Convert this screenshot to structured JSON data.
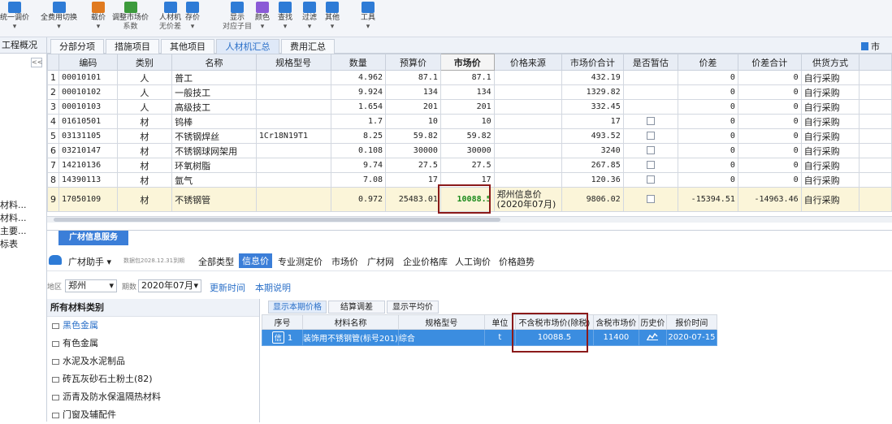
{
  "toolbar": [
    {
      "label": "统一调价",
      "sub": "",
      "color": "#2e7bd6",
      "icon": "adjust-price-icon"
    },
    {
      "label": "全费用切换",
      "sub": "",
      "color": "#2e7bd6",
      "icon": "full-cost-icon"
    },
    {
      "label": "载价",
      "sub": "",
      "color": "#e07a20",
      "icon": "load-price-icon"
    },
    {
      "label": "调整市场价",
      "sub": "系数",
      "color": "#3c9a3c",
      "icon": "coefficient-icon"
    },
    {
      "label": "人材机",
      "sub": "无价差",
      "color": "#2e7bd6",
      "icon": "scale-icon"
    },
    {
      "label": "存价",
      "sub": "",
      "color": "#2e7bd6",
      "icon": "save-price-icon"
    },
    {
      "label": "显示",
      "sub": "对应子目",
      "color": "#2e7bd6",
      "icon": "display-icon"
    },
    {
      "label": "颜色",
      "sub": "",
      "color": "#8a5ad6",
      "icon": "color-icon"
    },
    {
      "label": "查找",
      "sub": "",
      "color": "#2e7bd6",
      "icon": "find-icon"
    },
    {
      "label": "过滤",
      "sub": "",
      "color": "#2e7bd6",
      "icon": "filter-icon"
    },
    {
      "label": "其他",
      "sub": "",
      "color": "#2e7bd6",
      "icon": "other-icon"
    },
    {
      "label": "工具",
      "sub": "",
      "color": "#2e7bd6",
      "icon": "tools-icon"
    }
  ],
  "left": {
    "header": "工程概况",
    "items": [
      "材料...",
      "材料...",
      "主要...",
      "标表"
    ]
  },
  "tabs": [
    "分部分项",
    "措施项目",
    "其他项目",
    "人材机汇总",
    "费用汇总"
  ],
  "right_tab": "市",
  "grid": {
    "headers": [
      "",
      "编码",
      "类别",
      "名称",
      "规格型号",
      "数量",
      "预算价",
      "市场价",
      "价格来源",
      "市场价合计",
      "是否暂估",
      "价差",
      "价差合计",
      "供货方式"
    ],
    "rows": [
      {
        "no": "1",
        "code": "00010101",
        "cat": "人",
        "name": "普工",
        "spec": "",
        "qty": "4.962",
        "budget": "87.1",
        "market": "87.1",
        "src": "",
        "total": "432.19",
        "est": false,
        "diff": "0",
        "difftotal": "0",
        "supply": "自行采购"
      },
      {
        "no": "2",
        "code": "00010102",
        "cat": "人",
        "name": "一般技工",
        "spec": "",
        "qty": "9.924",
        "budget": "134",
        "market": "134",
        "src": "",
        "total": "1329.82",
        "est": false,
        "diff": "0",
        "difftotal": "0",
        "supply": "自行采购"
      },
      {
        "no": "3",
        "code": "00010103",
        "cat": "人",
        "name": "高级技工",
        "spec": "",
        "qty": "1.654",
        "budget": "201",
        "market": "201",
        "src": "",
        "total": "332.45",
        "est": false,
        "diff": "0",
        "difftotal": "0",
        "supply": "自行采购"
      },
      {
        "no": "4",
        "code": "01610501",
        "cat": "材",
        "name": "钨棒",
        "spec": "",
        "qty": "1.7",
        "budget": "10",
        "market": "10",
        "src": "",
        "total": "17",
        "est": true,
        "diff": "0",
        "difftotal": "0",
        "supply": "自行采购"
      },
      {
        "no": "5",
        "code": "03131105",
        "cat": "材",
        "name": "不锈钢焊丝",
        "spec": "1Cr18N19T1",
        "qty": "8.25",
        "budget": "59.82",
        "market": "59.82",
        "src": "",
        "total": "493.52",
        "est": true,
        "diff": "0",
        "difftotal": "0",
        "supply": "自行采购"
      },
      {
        "no": "6",
        "code": "03210147",
        "cat": "材",
        "name": "不锈钢球网架用",
        "spec": "",
        "qty": "0.108",
        "budget": "30000",
        "market": "30000",
        "src": "",
        "total": "3240",
        "est": true,
        "diff": "0",
        "difftotal": "0",
        "supply": "自行采购"
      },
      {
        "no": "7",
        "code": "14210136",
        "cat": "材",
        "name": "环氧树脂",
        "spec": "",
        "qty": "9.74",
        "budget": "27.5",
        "market": "27.5",
        "src": "",
        "total": "267.85",
        "est": true,
        "diff": "0",
        "difftotal": "0",
        "supply": "自行采购"
      },
      {
        "no": "8",
        "code": "14390113",
        "cat": "材",
        "name": "氩气",
        "spec": "",
        "qty": "7.08",
        "budget": "17",
        "market": "17",
        "src": "",
        "total": "120.36",
        "est": true,
        "diff": "0",
        "difftotal": "0",
        "supply": "自行采购"
      },
      {
        "no": "9",
        "code": "17050109",
        "cat": "材",
        "name": "不锈钢管",
        "spec": "",
        "qty": "0.972",
        "budget": "25483.01",
        "market": "10088.5",
        "src": "郑州信息价(2020年07月)",
        "total": "9806.02",
        "est": true,
        "diff": "-15394.51",
        "difftotal": "-14963.46",
        "supply": "自行采购"
      }
    ]
  },
  "panel": {
    "tab": "广材信息服务",
    "assistant": "广材助手",
    "assistant_note": "数据包2028.12.31到期",
    "sources": [
      "全部类型",
      "信息价",
      "专业测定价",
      "市场价",
      "广材网",
      "企业价格库",
      "人工询价",
      "价格趋势"
    ],
    "active_source": "信息价",
    "region_label": "地区",
    "region": "郑州",
    "period_label": "期数",
    "period": "2020年07月",
    "update_time": "更新时间",
    "period_note": "本期说明",
    "categories_title": "所有材料类别",
    "categories": [
      "黑色金属",
      "有色金属",
      "水泥及水泥制品",
      "砖瓦灰砂石土粉土(82)",
      "沥青及防水保温隔热材料",
      "门窗及辅配件"
    ],
    "subtabs": [
      "显示本期价格",
      "结算调差",
      "显示平均价"
    ],
    "result_headers": [
      "序号",
      "材料名称",
      "规格型号",
      "单位",
      "不含税市场价(除税)",
      "含税市场价",
      "历史价",
      "报价时间"
    ],
    "result_row": {
      "tag": "信",
      "no": "1",
      "name": "装饰用不锈钢管(标号201)",
      "spec": "综合",
      "unit": "t",
      "price_ex": "10088.5",
      "price_in": "11400",
      "time": "2020-07-15"
    }
  }
}
